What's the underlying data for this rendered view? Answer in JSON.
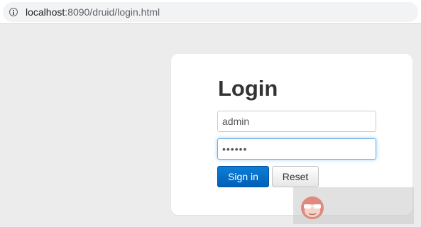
{
  "browser": {
    "url_host": "localhost",
    "url_rest": ":8090/druid/login.html"
  },
  "login": {
    "title": "Login",
    "username_value": "admin",
    "password_value": "••••••",
    "signin_label": "Sign in",
    "reset_label": "Reset"
  },
  "colors": {
    "page_bg": "#ececec",
    "primary": "#0d6fd0",
    "focus_border": "#66afe9"
  },
  "icons": {
    "address_bar": "info-icon",
    "overlay": "sunglasses-avatar-icon"
  }
}
